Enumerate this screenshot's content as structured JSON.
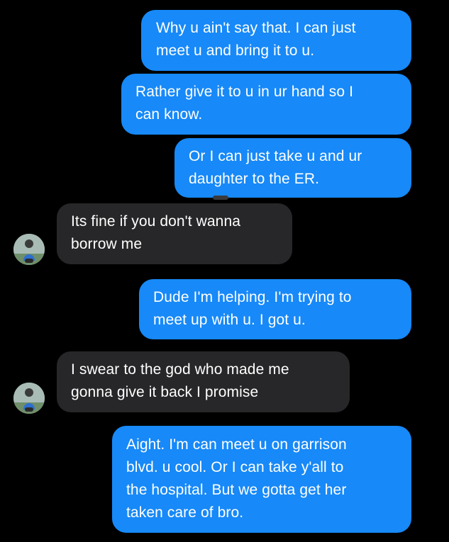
{
  "conversation": {
    "messages": [
      {
        "id": 1,
        "sender": "me",
        "text": "Why u ain't say that. I can just\nmeet u and bring it to u."
      },
      {
        "id": 2,
        "sender": "me",
        "text": "Rather give it to u in ur hand so I\ncan know."
      },
      {
        "id": 3,
        "sender": "me",
        "text": "Or I can just take u and ur\ndaughter to the ER."
      },
      {
        "id": 4,
        "sender": "them",
        "text": "Its fine if you don't wanna\nborrow me"
      },
      {
        "id": 5,
        "sender": "me",
        "text": "Dude I'm helping. I'm trying to\nmeet up with u. I got u."
      },
      {
        "id": 6,
        "sender": "them",
        "text": "I swear to the god who made me\ngonna give it back I promise"
      },
      {
        "id": 7,
        "sender": "me",
        "text": "Aight. I'm can meet u on garrison\nblvd. u cool. Or I can take y'all to\nthe hospital. But we gotta get her\ntaken care of bro."
      }
    ]
  },
  "theme": {
    "background": "#000000",
    "sent_bubble": "#1789f8",
    "received_bubble": "#272729",
    "text": "#ffffff"
  },
  "icons": {
    "contact_avatar": "contact-avatar-icon"
  }
}
